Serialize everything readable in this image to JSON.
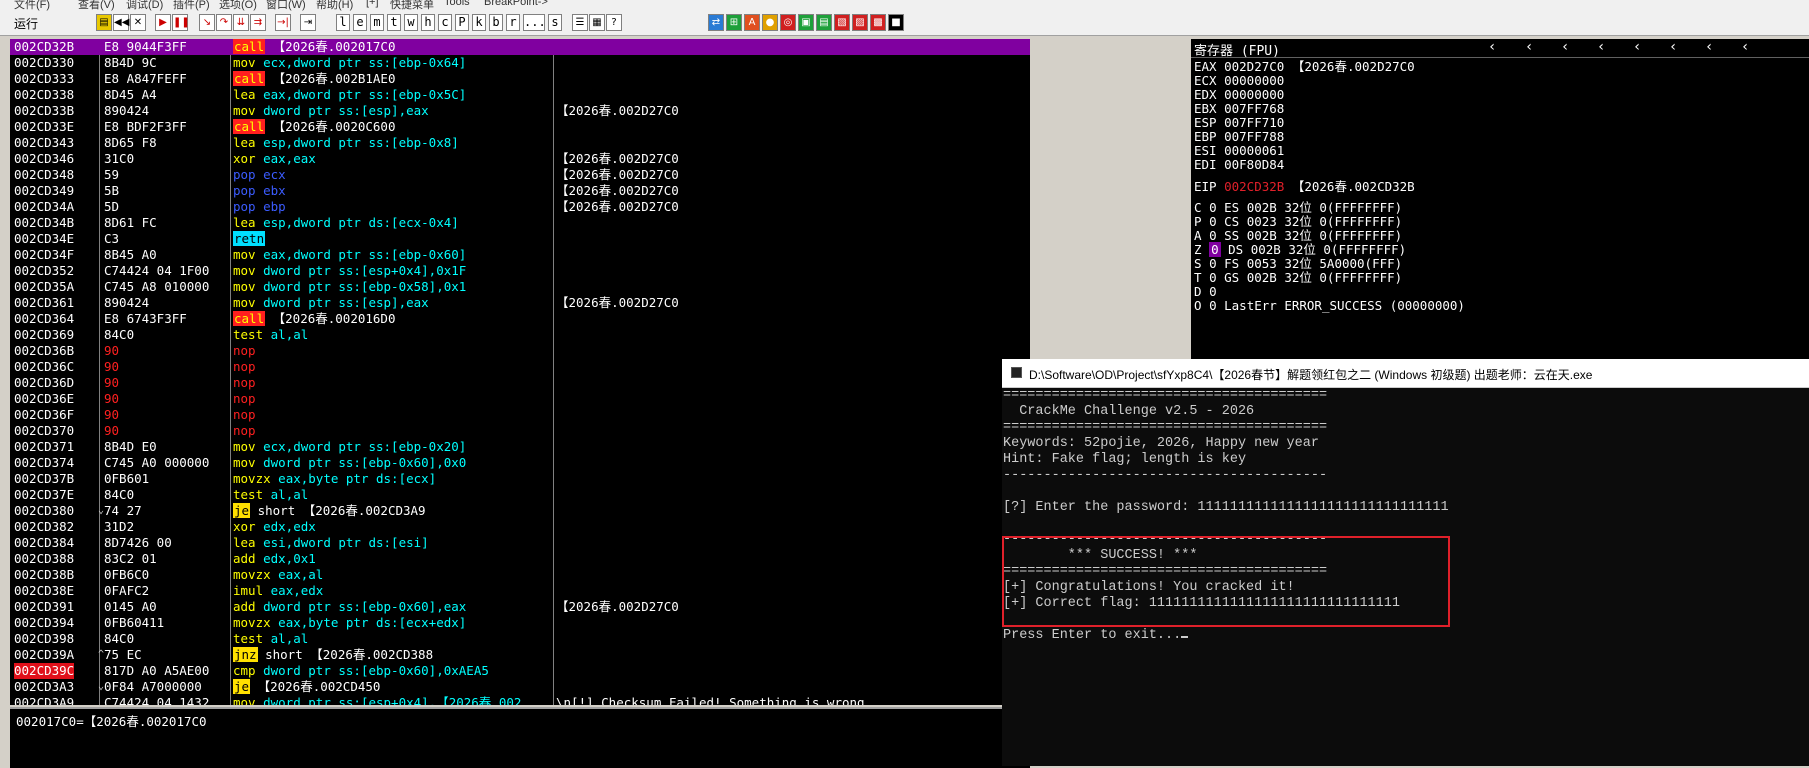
{
  "menu": {
    "items": [
      "文件(F)",
      "查看(V)",
      "调试(D)",
      "插件(P)",
      "选项(O)",
      "窗口(W)",
      "帮助(H)",
      "[+]",
      "快捷菜单",
      "Tools",
      "BreakPoint->"
    ]
  },
  "toolbar": {
    "status": "运行",
    "letters": [
      "l",
      "e",
      "m",
      "t",
      "w",
      "h",
      "c",
      "P",
      "k",
      "b",
      "r",
      "...",
      "s"
    ]
  },
  "cpu": {
    "rows": [
      {
        "addr": "002CD32B",
        "hex": "E8 9044F3FF",
        "mn": "call",
        "ops": "【2026春.002017C0",
        "cmt": "",
        "sel": true
      },
      {
        "addr": "002CD330",
        "hex": "8B4D 9C",
        "mn": "mov",
        "ops": "ecx,dword ptr ss:[ebp-0x64]",
        "cmt": ""
      },
      {
        "addr": "002CD333",
        "hex": "E8 A847FEFF",
        "mn": "call",
        "ops": "【2026春.002B1AE0",
        "cmt": ""
      },
      {
        "addr": "002CD338",
        "hex": "8D45 A4",
        "mn": "lea",
        "ops": "eax,dword ptr ss:[ebp-0x5C]",
        "cmt": ""
      },
      {
        "addr": "002CD33B",
        "hex": "890424",
        "mn": "mov",
        "ops": "dword ptr ss:[esp],eax",
        "cmt": "【2026春.002D27C0"
      },
      {
        "addr": "002CD33E",
        "hex": "E8 BDF2F3FF",
        "mn": "call",
        "ops": "【2026春.0020C600",
        "cmt": ""
      },
      {
        "addr": "002CD343",
        "hex": "8D65 F8",
        "mn": "lea",
        "ops": "esp,dword ptr ss:[ebp-0x8]",
        "cmt": ""
      },
      {
        "addr": "002CD346",
        "hex": "31C0",
        "mn": "xor",
        "ops": "eax,eax",
        "cmt": "【2026春.002D27C0"
      },
      {
        "addr": "002CD348",
        "hex": "59",
        "mn": "pop",
        "ops": "ecx",
        "cmt": "【2026春.002D27C0"
      },
      {
        "addr": "002CD349",
        "hex": "5B",
        "mn": "pop",
        "ops": "ebx",
        "cmt": "【2026春.002D27C0"
      },
      {
        "addr": "002CD34A",
        "hex": "5D",
        "mn": "pop",
        "ops": "ebp",
        "cmt": "【2026春.002D27C0"
      },
      {
        "addr": "002CD34B",
        "hex": "8D61 FC",
        "mn": "lea",
        "ops": "esp,dword ptr ds:[ecx-0x4]",
        "cmt": ""
      },
      {
        "addr": "002CD34E",
        "hex": "C3",
        "mn": "retn",
        "ops": "",
        "cmt": ""
      },
      {
        "addr": "002CD34F",
        "hex": "8B45 A0",
        "mn": "mov",
        "ops": "eax,dword ptr ss:[ebp-0x60]",
        "cmt": ""
      },
      {
        "addr": "002CD352",
        "hex": "C74424 04 1F00",
        "mn": "mov",
        "ops": "dword ptr ss:[esp+0x4],0x1F",
        "cmt": ""
      },
      {
        "addr": "002CD35A",
        "hex": "C745 A8 010000",
        "mn": "mov",
        "ops": "dword ptr ss:[ebp-0x58],0x1",
        "cmt": ""
      },
      {
        "addr": "002CD361",
        "hex": "890424",
        "mn": "mov",
        "ops": "dword ptr ss:[esp],eax",
        "cmt": "【2026春.002D27C0"
      },
      {
        "addr": "002CD364",
        "hex": "E8 6743F3FF",
        "mn": "call",
        "ops": "【2026春.002016D0",
        "cmt": ""
      },
      {
        "addr": "002CD369",
        "hex": "84C0",
        "mn": "test",
        "ops": "al,al",
        "cmt": ""
      },
      {
        "addr": "002CD36B",
        "hex": "90",
        "mn": "nop",
        "ops": "",
        "cmt": ""
      },
      {
        "addr": "002CD36C",
        "hex": "90",
        "mn": "nop",
        "ops": "",
        "cmt": ""
      },
      {
        "addr": "002CD36D",
        "hex": "90",
        "mn": "nop",
        "ops": "",
        "cmt": ""
      },
      {
        "addr": "002CD36E",
        "hex": "90",
        "mn": "nop",
        "ops": "",
        "cmt": ""
      },
      {
        "addr": "002CD36F",
        "hex": "90",
        "mn": "nop",
        "ops": "",
        "cmt": ""
      },
      {
        "addr": "002CD370",
        "hex": "90",
        "mn": "nop",
        "ops": "",
        "cmt": ""
      },
      {
        "addr": "002CD371",
        "hex": "8B4D E0",
        "mn": "mov",
        "ops": "ecx,dword ptr ss:[ebp-0x20]",
        "cmt": ""
      },
      {
        "addr": "002CD374",
        "hex": "C745 A0 000000",
        "mn": "mov",
        "ops": "dword ptr ss:[ebp-0x60],0x0",
        "cmt": ""
      },
      {
        "addr": "002CD37B",
        "hex": "0FB601",
        "mn": "movzx",
        "ops": "eax,byte ptr ds:[ecx]",
        "cmt": ""
      },
      {
        "addr": "002CD37E",
        "hex": "84C0",
        "mn": "test",
        "ops": "al,al",
        "cmt": ""
      },
      {
        "addr": "002CD380",
        "hex": "74 27",
        "mn": "je",
        "ops": "short 【2026春.002CD3A9",
        "cmt": "",
        "jm": "⌄"
      },
      {
        "addr": "002CD382",
        "hex": "31D2",
        "mn": "xor",
        "ops": "edx,edx",
        "cmt": ""
      },
      {
        "addr": "002CD384",
        "hex": "8D7426 00",
        "mn": "lea",
        "ops": "esi,dword ptr ds:[esi]",
        "cmt": ""
      },
      {
        "addr": "002CD388",
        "hex": "83C2 01",
        "mn": "add",
        "ops": "edx,0x1",
        "cmt": ""
      },
      {
        "addr": "002CD38B",
        "hex": "0FB6C0",
        "mn": "movzx",
        "ops": "eax,al",
        "cmt": ""
      },
      {
        "addr": "002CD38E",
        "hex": "0FAFC2",
        "mn": "imul",
        "ops": "eax,edx",
        "cmt": ""
      },
      {
        "addr": "002CD391",
        "hex": "0145 A0",
        "mn": "add",
        "ops": "dword ptr ss:[ebp-0x60],eax",
        "cmt": "【2026春.002D27C0"
      },
      {
        "addr": "002CD394",
        "hex": "0FB60411",
        "mn": "movzx",
        "ops": "eax,byte ptr ds:[ecx+edx]",
        "cmt": ""
      },
      {
        "addr": "002CD398",
        "hex": "84C0",
        "mn": "test",
        "ops": "al,al",
        "cmt": ""
      },
      {
        "addr": "002CD39A",
        "hex": "75 EC",
        "mn": "jnz",
        "ops": "short 【2026春.002CD388",
        "cmt": "",
        "jm": "^"
      },
      {
        "addr": "002CD39C",
        "hex": "817D A0 A5AE00",
        "mn": "cmp",
        "ops": "dword ptr ss:[ebp-0x60],0xAEA5",
        "cmt": "",
        "bp": true
      },
      {
        "addr": "002CD3A3",
        "hex": "0F84 A7000000",
        "mn": "je",
        "ops": "【2026春.002CD450",
        "cmt": "",
        "jm": "⌄"
      },
      {
        "addr": "002CD3A9",
        "hex": "C74424 04 1432",
        "mn": "mov",
        "ops": "dword ptr ss:[esp+0x4],【2026春.002",
        "cmt": "\\n[!] Checksum Failed! Something is wrong..."
      }
    ],
    "info": "002017C0=【2026春.002017C0"
  },
  "registers": {
    "title": "寄存器 (FPU)",
    "gp": [
      {
        "name": "EAX",
        "value": "002D27C0",
        "note": "【2026春.002D27C0"
      },
      {
        "name": "ECX",
        "value": "00000000",
        "note": ""
      },
      {
        "name": "EDX",
        "value": "00000000",
        "note": ""
      },
      {
        "name": "EBX",
        "value": "007FF768",
        "note": ""
      },
      {
        "name": "ESP",
        "value": "007FF710",
        "note": ""
      },
      {
        "name": "EBP",
        "value": "007FF788",
        "note": ""
      },
      {
        "name": "ESI",
        "value": "00000061",
        "note": ""
      },
      {
        "name": "EDI",
        "value": "00F80D84",
        "note": ""
      }
    ],
    "eip": {
      "name": "EIP",
      "value": "002CD32B",
      "note": "【2026春.002CD32B"
    },
    "flags": [
      {
        "flag": "C",
        "bit": "0",
        "seg": "ES 002B 32位 0(FFFFFFFF)"
      },
      {
        "flag": "P",
        "bit": "0",
        "seg": "CS 0023 32位 0(FFFFFFFF)"
      },
      {
        "flag": "A",
        "bit": "0",
        "seg": "SS 002B 32位 0(FFFFFFFF)"
      },
      {
        "flag": "Z",
        "bit": "0",
        "seg": "DS 002B 32位 0(FFFFFFFF)",
        "hl": true
      },
      {
        "flag": "S",
        "bit": "0",
        "seg": "FS 0053 32位 5A0000(FFF)"
      },
      {
        "flag": "T",
        "bit": "0",
        "seg": "GS 002B 32位 0(FFFFFFFF)"
      },
      {
        "flag": "D",
        "bit": "0",
        "seg": ""
      },
      {
        "flag": "O",
        "bit": "0",
        "seg": "LastErr ERROR_SUCCESS (00000000)"
      }
    ]
  },
  "console": {
    "title": "D:\\Software\\OD\\Project\\sfYxp8C4\\【2026春节】解题领红包之二 (Windows 初级题) 出题老师：云在天.exe",
    "lines": [
      "========================================",
      "  CrackMe Challenge v2.5 - 2026",
      "========================================",
      "Keywords: 52pojie, 2026, Happy new year",
      "Hint: Fake flag; length is key",
      "----------------------------------------",
      "",
      "[?] Enter the password: 1111111111111111111111111111111",
      "",
      "----------------------------------------",
      "        *** SUCCESS! ***",
      "========================================",
      "[+] Congratulations! You cracked it!",
      "[+] Correct flag: 1111111111111111111111111111111",
      "",
      "Press Enter to exit..."
    ]
  },
  "colors": {
    "selection": "#8000a0",
    "call_bg": "#ff1f1f",
    "jump_bg": "#ffe000",
    "ret_bg": "#00e0ff",
    "success_box": "#e0202a"
  }
}
